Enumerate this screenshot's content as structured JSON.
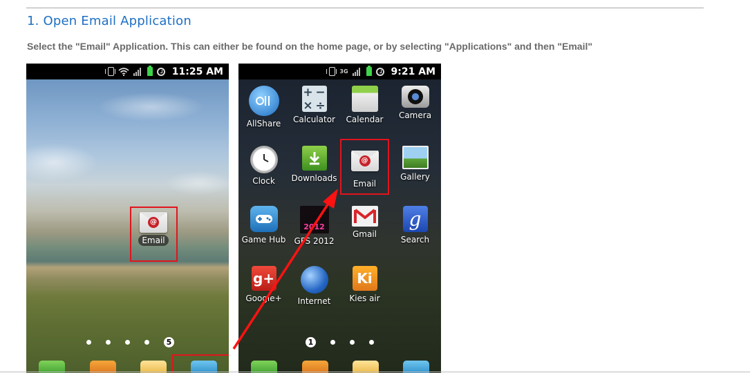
{
  "heading": "1. Open Email Application",
  "instruction": "Select the \"Email\" Application. This can either be found on the home page, or by selecting \"Applications\" and then \"Email\"",
  "left_phone": {
    "status_time": "11:25 AM",
    "home_icon_label": "Email",
    "pager_current": "5"
  },
  "right_phone": {
    "status_time": "9:21 AM",
    "status_network": "3G",
    "pager_current": "1",
    "apps": [
      {
        "label": "AllShare",
        "icon": "allshare-icon"
      },
      {
        "label": "Calculator",
        "icon": "calculator-icon"
      },
      {
        "label": "Calendar",
        "icon": "calendar-icon"
      },
      {
        "label": "Camera",
        "icon": "camera-icon"
      },
      {
        "label": "Clock",
        "icon": "clock-icon"
      },
      {
        "label": "Downloads",
        "icon": "downloads-icon"
      },
      {
        "label": "Email",
        "icon": "email-icon"
      },
      {
        "label": "Gallery",
        "icon": "gallery-icon"
      },
      {
        "label": "Game Hub",
        "icon": "gamepad-icon"
      },
      {
        "label": "GFS 2012",
        "icon": "gfs-icon"
      },
      {
        "label": "Gmail",
        "icon": "gmail-icon"
      },
      {
        "label": "Search",
        "icon": "google-search-icon"
      },
      {
        "label": "Google+",
        "icon": "google-plus-icon"
      },
      {
        "label": "Internet",
        "icon": "globe-icon"
      },
      {
        "label": "Kies air",
        "icon": "kies-air-icon"
      }
    ]
  },
  "colors": {
    "heading": "#1d6fc4",
    "highlight": "#e2141c",
    "battery": "#3fd34b"
  }
}
